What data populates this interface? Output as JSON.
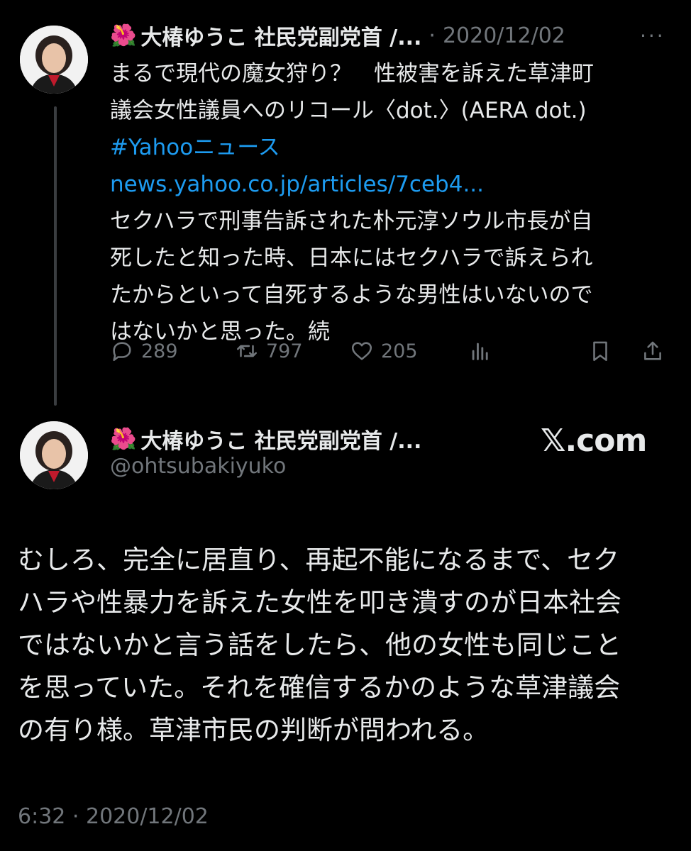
{
  "tweet1": {
    "author_name": "大椿ゆうこ 社民党副党首 /...",
    "flower_icon": "hibiscus",
    "separator": "·",
    "date": "2020/12/02",
    "more_label": "···",
    "lines": [
      {
        "text": "まるで現代の魔女狩り？　性被害を訴えた草津町",
        "style": "normal"
      },
      {
        "text": "議会女性議員へのリコール〈dot.〉(AERA dot.)",
        "style": "normal"
      },
      {
        "text": "#Yahooニュース",
        "style": "link"
      },
      {
        "text": "news.yahoo.co.jp/articles/7ceb4...",
        "style": "link"
      },
      {
        "text": "セクハラで刑事告訴された朴元淳ソウル市長が自",
        "style": "normal"
      },
      {
        "text": "死したと知った時、日本にはセクハラで訴えられ",
        "style": "normal"
      },
      {
        "text": "たからといって自死するような男性はいないので",
        "style": "normal"
      },
      {
        "text": "はないかと思った。続",
        "style": "normal"
      }
    ],
    "actions": {
      "reply_count": "289",
      "retweet_count": "797",
      "like_count": "205"
    }
  },
  "tweet2": {
    "author_name": "大椿ゆうこ 社民党副党首 /...",
    "handle": "@ohtsubakiyuko",
    "watermark": "𝕏.com",
    "lines": [
      "むしろ、完全に居直り、再起不能になるまで、セク",
      "ハラや性暴力を訴えた女性を叩き潰すのが日本社会",
      "ではないかと言う話をしたら、他の女性も同じこと",
      "を思っていた。それを確信するかのような草津議会",
      "の有り様。草津市民の判断が問われる。"
    ],
    "timestamp": "6:32 · 2020/12/02"
  },
  "colors": {
    "background": "#000000",
    "text": "#e7e9ea",
    "muted": "#71767b",
    "link": "#1d9bf0",
    "thread_line": "#3a3d40"
  }
}
